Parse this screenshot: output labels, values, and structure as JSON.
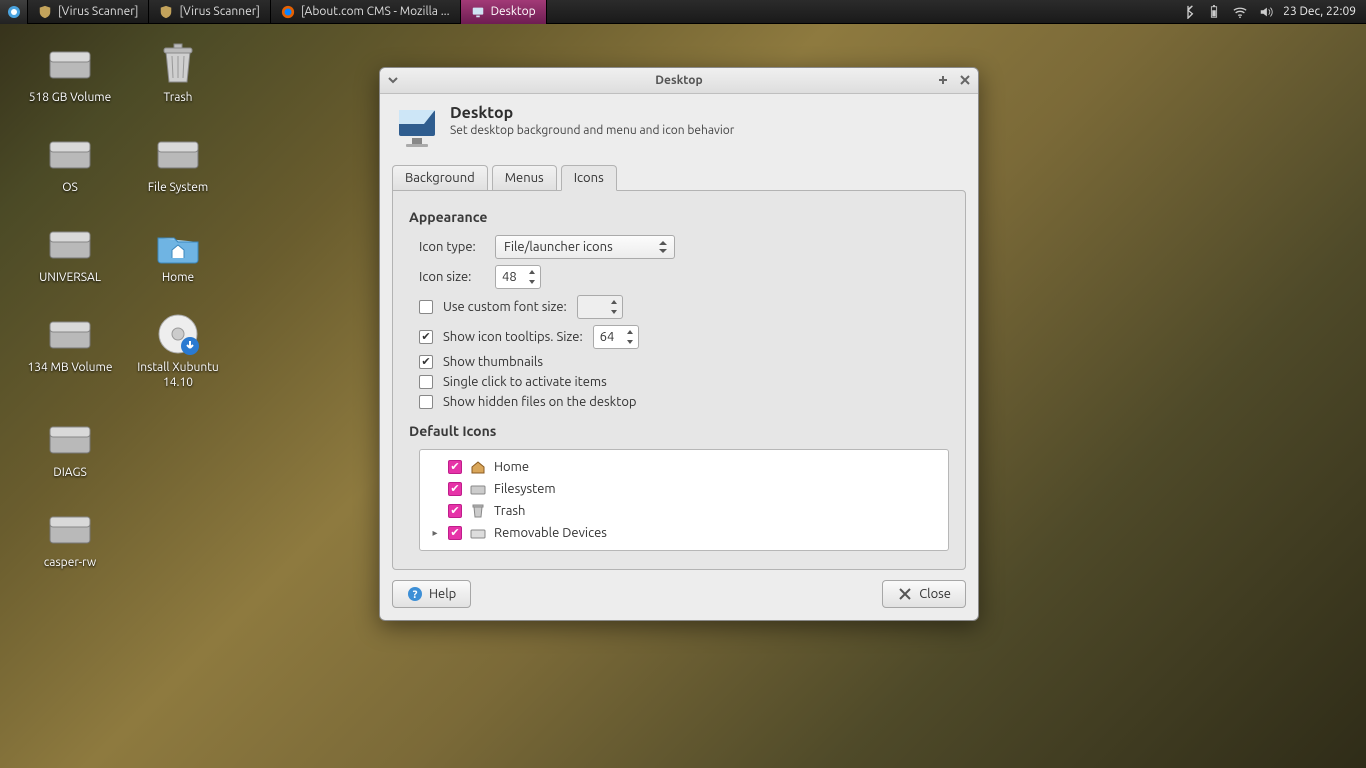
{
  "panel": {
    "tasks": [
      {
        "label": "[Virus Scanner]"
      },
      {
        "label": "[Virus Scanner]"
      },
      {
        "label": "[About.com CMS - Mozilla ..."
      },
      {
        "label": "Desktop",
        "active": true
      }
    ],
    "clock": "23 Dec, 22:09"
  },
  "desktop_icons": [
    {
      "label": "518 GB Volume",
      "kind": "hdd"
    },
    {
      "label": "Trash",
      "kind": "trash"
    },
    {
      "label": "OS",
      "kind": "hdd"
    },
    {
      "label": "File System",
      "kind": "hdd"
    },
    {
      "label": "UNIVERSAL",
      "kind": "hdd"
    },
    {
      "label": "Home",
      "kind": "folder"
    },
    {
      "label": "134 MB Volume",
      "kind": "hdd"
    },
    {
      "label": "Install Xubuntu 14.10",
      "kind": "disc"
    },
    {
      "label": "DIAGS",
      "kind": "hdd"
    },
    {
      "label": "",
      "kind": ""
    },
    {
      "label": "casper-rw",
      "kind": "hdd"
    },
    {
      "label": "",
      "kind": ""
    }
  ],
  "window": {
    "title": "Desktop",
    "header_title": "Desktop",
    "header_sub": "Set desktop background and menu and icon behavior",
    "tabs": [
      "Background",
      "Menus",
      "Icons"
    ],
    "active_tab": 2,
    "appearance": {
      "section": "Appearance",
      "icon_type_label": "Icon type:",
      "icon_type_value": "File/launcher icons",
      "icon_size_label": "Icon size:",
      "icon_size_value": "48",
      "custom_font_label": "Use custom font size:",
      "custom_font_checked": false,
      "custom_font_value": "",
      "tooltips_label": "Show icon tooltips. Size:",
      "tooltips_checked": true,
      "tooltips_value": "64",
      "thumbnails_label": "Show thumbnails",
      "thumbnails_checked": true,
      "single_click_label": "Single click to activate items",
      "single_click_checked": false,
      "hidden_label": "Show hidden files on the desktop",
      "hidden_checked": false
    },
    "default_icons": {
      "section": "Default Icons",
      "items": [
        {
          "label": "Home",
          "checked": true,
          "icon": "home",
          "expandable": false
        },
        {
          "label": "Filesystem",
          "checked": true,
          "icon": "fs",
          "expandable": false
        },
        {
          "label": "Trash",
          "checked": true,
          "icon": "trash",
          "expandable": false
        },
        {
          "label": "Removable Devices",
          "checked": true,
          "icon": "removable",
          "expandable": true
        }
      ]
    },
    "help_label": "Help",
    "close_label": "Close"
  }
}
